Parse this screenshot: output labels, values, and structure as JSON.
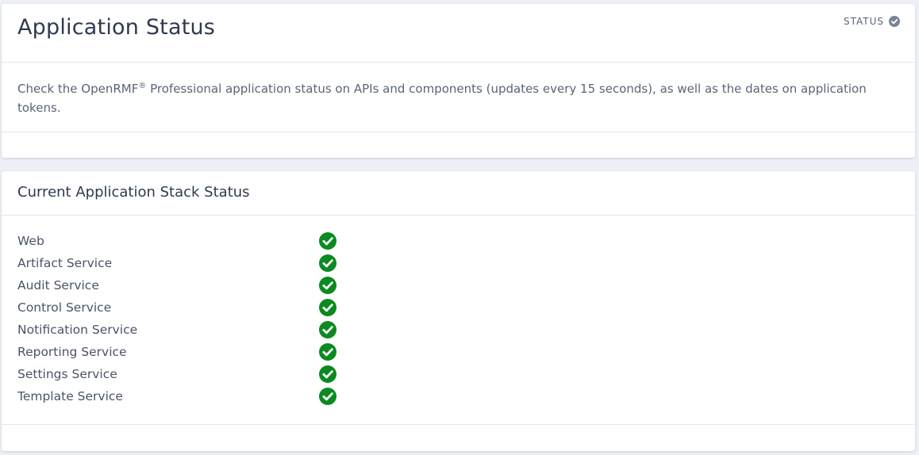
{
  "status_card": {
    "title": "Application Status",
    "status_label": "STATUS",
    "status_icon": "check-circle-icon",
    "description_before": "Check the OpenRMF",
    "description_registered": "®",
    "description_after": " Professional application status on APIs and components (updates every 15 seconds), as well as the dates on application tokens."
  },
  "stack_card": {
    "title": "Current Application Stack Status",
    "services": [
      {
        "name": "Web",
        "status_icon": "green-check-circle-icon"
      },
      {
        "name": "Artifact Service",
        "status_icon": "green-check-circle-icon"
      },
      {
        "name": "Audit Service",
        "status_icon": "green-check-circle-icon"
      },
      {
        "name": "Control Service",
        "status_icon": "green-check-circle-icon"
      },
      {
        "name": "Notification Service",
        "status_icon": "green-check-circle-icon"
      },
      {
        "name": "Reporting Service",
        "status_icon": "green-check-circle-icon"
      },
      {
        "name": "Settings Service",
        "status_icon": "green-check-circle-icon"
      },
      {
        "name": "Template Service",
        "status_icon": "green-check-circle-icon"
      }
    ]
  },
  "colors": {
    "background": "#edf0f6",
    "card": "#ffffff",
    "ok_green": "#0a8a1f",
    "status_icon_gray": "#7a8396"
  }
}
